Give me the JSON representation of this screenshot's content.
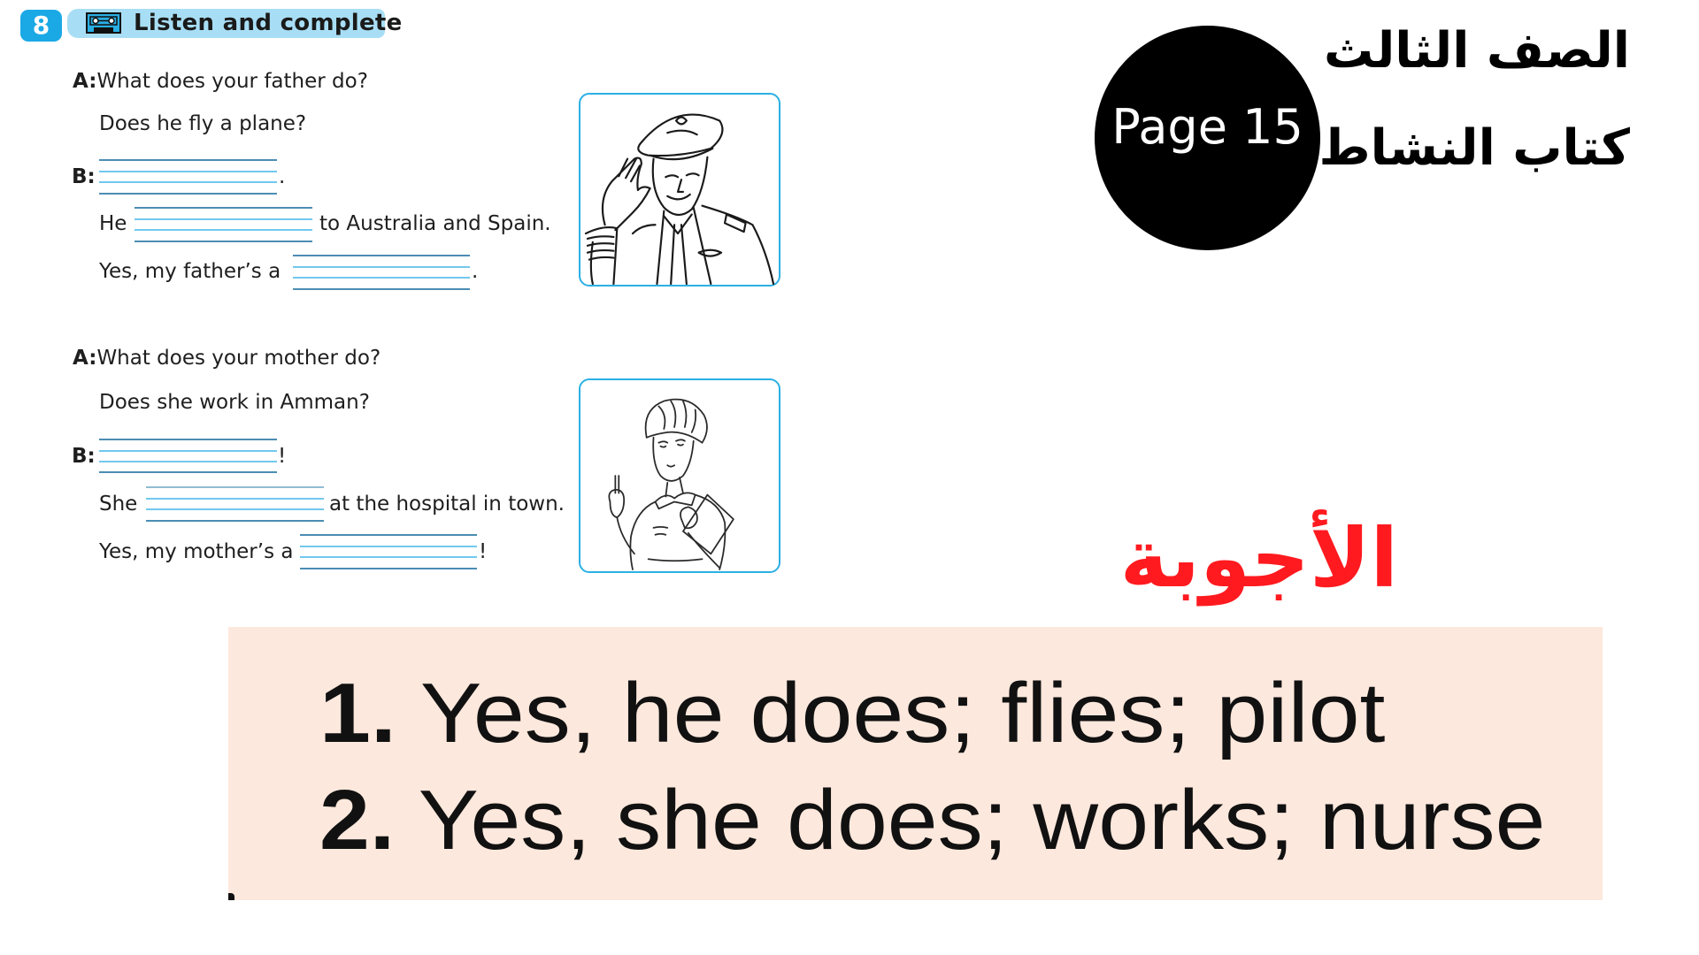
{
  "exercise": {
    "number": "8",
    "icon": "cassette-tape-icon",
    "title": "Listen and complete",
    "dialogues": [
      {
        "a_label": "A:",
        "question": "What does your father do?",
        "follow_up": "Does he fly a plane?",
        "b_label": "B:",
        "b_end": ".",
        "line2_start": "He",
        "line2_end": "to Australia and Spain.",
        "line3_start": "Yes, my father’s a",
        "line3_end": ".",
        "picture": "pilot-illustration"
      },
      {
        "a_label": "A:",
        "question": "What does your mother do?",
        "follow_up": "Does she work in Amman?",
        "b_label": "B:",
        "b_end": "!",
        "line2_start": "She",
        "line2_end": "at the hospital in town.",
        "line3_start": "Yes, my mother’s a",
        "line3_end": "!",
        "picture": "nurse-illustration"
      }
    ]
  },
  "header": {
    "page_label": "Page 15",
    "grade": "الصف الثالث",
    "book": "كتاب النشاط"
  },
  "answers": {
    "heading": "الأجوبة",
    "items": [
      {
        "num": "1.",
        "text": "Yes, he does; flies; pilot"
      },
      {
        "num": "2.",
        "text": "Yes, she does; works; nurse"
      }
    ]
  },
  "colors": {
    "badge_blue": "#1ba9e6",
    "header_bar": "#a8def5",
    "frame_border": "#2bb0e4",
    "answers_heading": "#ff1a1f",
    "answer_box_bg": "#fde8dd"
  }
}
